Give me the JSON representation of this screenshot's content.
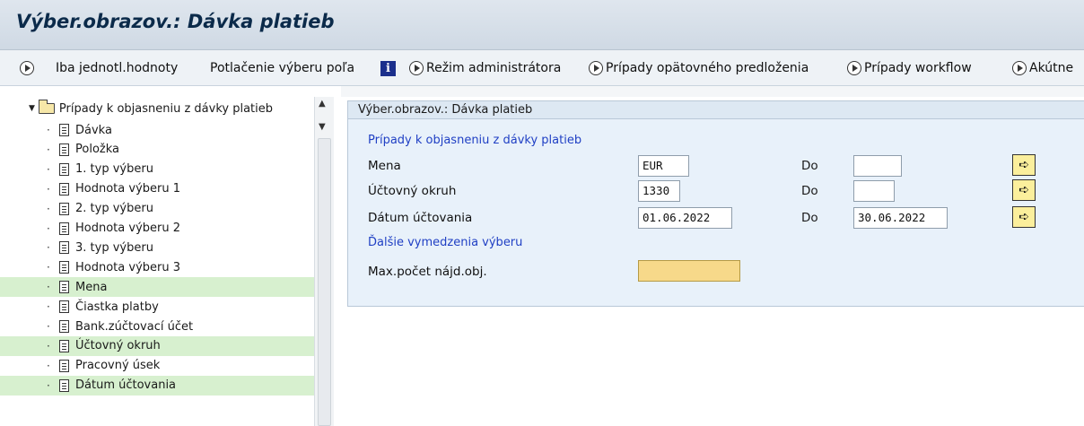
{
  "window": {
    "title": "Výber.obrazov.: Dávka platieb"
  },
  "toolbar": {
    "single_values": "Iba jednotl.hodnoty",
    "suppress_field": "Potlačenie výberu poľa",
    "admin_mode": "Režim administrátora",
    "resubmit_cases": "Prípady opätovného predloženia",
    "workflow_cases": "Prípady workflow",
    "urgent": "Akútne"
  },
  "tree": {
    "root": "Prípady k objasneniu z dávky platieb",
    "items": [
      {
        "label": "Dávka",
        "highlighted": false
      },
      {
        "label": "Položka",
        "highlighted": false
      },
      {
        "label": "1. typ výberu",
        "highlighted": false
      },
      {
        "label": "Hodnota výberu 1",
        "highlighted": false
      },
      {
        "label": "2. typ výberu",
        "highlighted": false
      },
      {
        "label": "Hodnota výberu 2",
        "highlighted": false
      },
      {
        "label": "3. typ výberu",
        "highlighted": false
      },
      {
        "label": "Hodnota výberu 3",
        "highlighted": false
      },
      {
        "label": "Mena",
        "highlighted": true
      },
      {
        "label": "Čiastka platby",
        "highlighted": false
      },
      {
        "label": "Bank.zúčtovací účet",
        "highlighted": false
      },
      {
        "label": "Účtovný okruh",
        "highlighted": true
      },
      {
        "label": "Pracovný úsek",
        "highlighted": false
      },
      {
        "label": "Dátum účtovania",
        "highlighted": true
      }
    ],
    "highlight_color": "#d7f0cf"
  },
  "form": {
    "header": "Výber.obrazov.: Dávka platieb",
    "group1": "Prípady k objasneniu z dávky platieb",
    "group2": "Ďalšie vymedzenia výberu",
    "to_label": "Do",
    "rows": {
      "currency": {
        "label": "Mena",
        "from": "EUR",
        "to": ""
      },
      "company_code": {
        "label": "Účtovný okruh",
        "from": "1330",
        "to": ""
      },
      "posting_date": {
        "label": "Dátum účtovania",
        "from": "01.06.2022",
        "to": "30.06.2022"
      }
    },
    "max_hits": {
      "label": "Max.počet nájd.obj.",
      "value": ""
    }
  }
}
